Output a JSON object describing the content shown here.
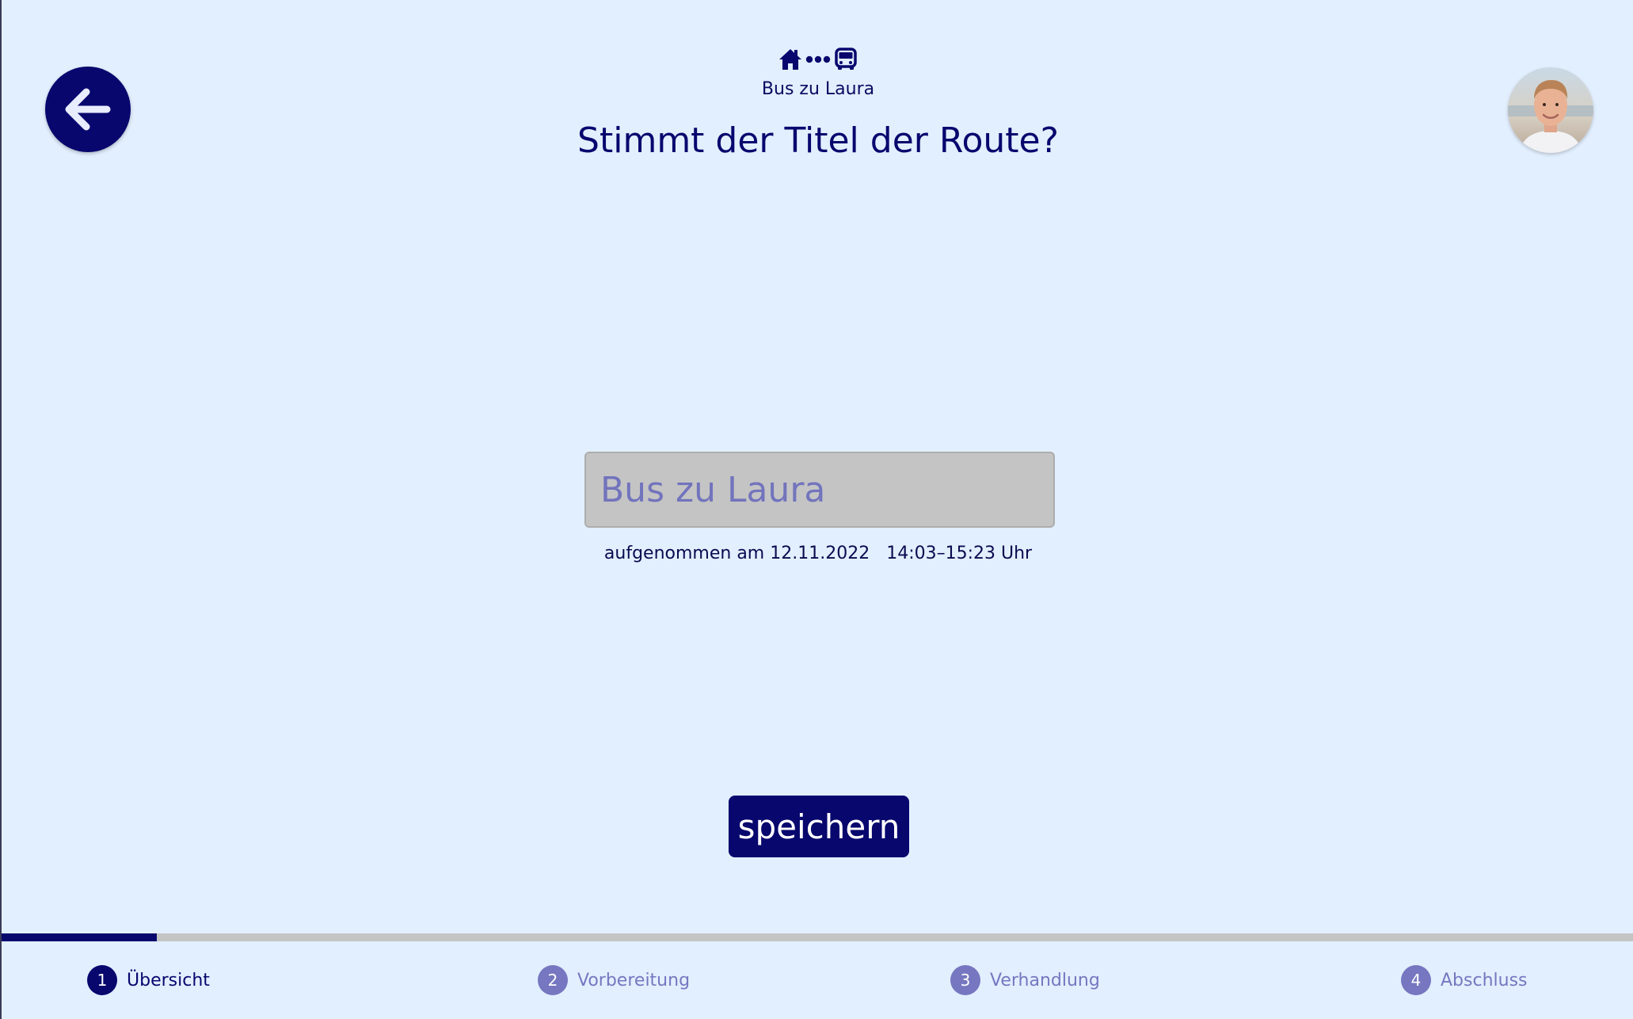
{
  "header": {
    "route_name": "Bus zu Laura",
    "question": "Stimmt der Titel der Route?",
    "icons": [
      "home-icon",
      "dots-icon",
      "bus-icon"
    ]
  },
  "back_button": {
    "icon": "arrow-left-icon"
  },
  "user": {
    "avatar": "user-avatar"
  },
  "form": {
    "title_value": "Bus zu Laura",
    "recorded_prefix": "aufgenommen am",
    "recorded_date": "12.11.2022",
    "recorded_time": "14:03–15:23 Uhr",
    "save_label": "speichern"
  },
  "progress": {
    "fraction": 0.095
  },
  "steps": [
    {
      "number": "1",
      "label": "Übersicht",
      "active": true
    },
    {
      "number": "2",
      "label": "Vorbereitung",
      "active": false
    },
    {
      "number": "3",
      "label": "Verhandlung",
      "active": false
    },
    {
      "number": "4",
      "label": "Abschluss",
      "active": false
    }
  ],
  "colors": {
    "background": "#e2effe",
    "primary": "#07076e",
    "inactive": "#7677c0",
    "track": "#c4c4c4"
  }
}
